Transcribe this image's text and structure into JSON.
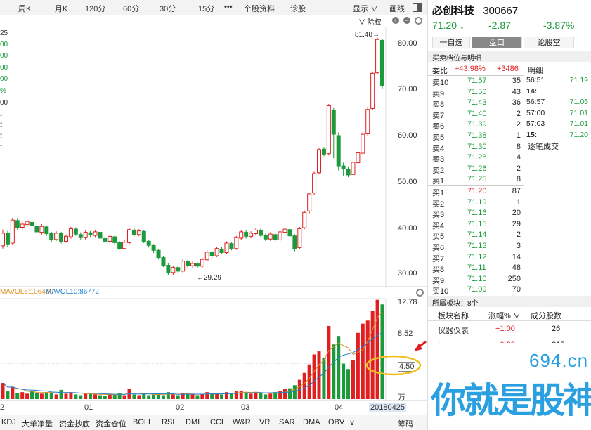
{
  "toolbar": {
    "items": [
      "周K",
      "月K",
      "120分",
      "60分",
      "30分",
      "15分",
      "个股资料",
      "诊股"
    ],
    "more_label": "•••",
    "display_label": "显示",
    "draw_label": "画线",
    "adjust_label": "除权"
  },
  "stock": {
    "name": "必创科技",
    "code": "300667",
    "price": "71.20",
    "arrow": "↓",
    "change": "-2.87",
    "pct": "-3.87%"
  },
  "tabs": {
    "watch": "一自选",
    "orderbook": "盘口",
    "forum": "论股堂"
  },
  "orderbook": {
    "section_title": "买卖档位与明细",
    "weibi_label": "委比",
    "weibi_pct": "+43.98%",
    "weibi_num": "+3486",
    "asks": [
      [
        "卖10",
        "71.57",
        "35"
      ],
      [
        "卖9",
        "71.50",
        "43"
      ],
      [
        "卖8",
        "71.43",
        "36"
      ],
      [
        "卖7",
        "71.40",
        "2"
      ],
      [
        "卖6",
        "71.39",
        "2"
      ],
      [
        "卖5",
        "71.38",
        "1"
      ],
      [
        "卖4",
        "71.30",
        "8"
      ],
      [
        "卖3",
        "71.28",
        "4"
      ],
      [
        "卖2",
        "71.26",
        "2"
      ],
      [
        "卖1",
        "71.25",
        "8"
      ]
    ],
    "bids": [
      [
        "买1",
        "71.20",
        "87"
      ],
      [
        "买2",
        "71.19",
        "1"
      ],
      [
        "买3",
        "71.16",
        "20"
      ],
      [
        "买4",
        "71.15",
        "29"
      ],
      [
        "买5",
        "71.14",
        "2"
      ],
      [
        "买6",
        "71.13",
        "3"
      ],
      [
        "买7",
        "71.12",
        "14"
      ],
      [
        "买8",
        "71.11",
        "48"
      ],
      [
        "买9",
        "71.10",
        "250"
      ],
      [
        "买10",
        "71.09",
        "70"
      ]
    ]
  },
  "ticks": {
    "title": "明细",
    "rows": [
      [
        "56:51",
        "71.19"
      ],
      [
        "14:",
        ""
      ],
      [
        "56:57",
        "71.05"
      ],
      [
        "57:00",
        "71.01"
      ],
      [
        "57:03",
        "71.01"
      ],
      [
        "15:",
        "71.20"
      ]
    ],
    "more": "逐笔成交"
  },
  "sector": {
    "title": "所属板块：8个",
    "col_name": "板块名称",
    "col_chg": "涨幅%",
    "col_cnt": "成分股数",
    "rows": [
      [
        "仪器仪表",
        "+1.00",
        "26"
      ],
      [
        "新股与次",
        "+0.88",
        "215"
      ]
    ]
  },
  "left_labels": [
    "25",
    "00",
    "00",
    "00",
    "00",
    "%",
    "00",
    "--",
    "--",
    "--"
  ],
  "price_axis": [
    "80.00",
    "70.00",
    "60.00",
    "50.00",
    "40.00",
    "30.00"
  ],
  "annotations": {
    "high": "81.48→",
    "low": "←29.29"
  },
  "volume": {
    "mavol5": "MAVOL5:106460",
    "mavol10": "MAVOL10:86772",
    "axis": [
      "12.78",
      "8.52",
      "4.50"
    ],
    "unit": "万"
  },
  "x_labels": [
    "2",
    "01",
    "02",
    "03",
    "04"
  ],
  "date_label": "20180425",
  "bottom_tabs": [
    "KDJ",
    "大单净量",
    "资金抄底",
    "资金仓位",
    "BOLL",
    "RSI",
    "DMI",
    "CCI",
    "W&R",
    "VR",
    "SAR",
    "DMA",
    "OBV"
  ],
  "chip_label": "筹码",
  "watermark": {
    "site": "694.cn",
    "slogan": "你就是股神"
  },
  "colors": {
    "up": "#e02020",
    "down": "#1a9a3a",
    "accent": "#f0c020"
  },
  "chart_data": {
    "type": "candlestick",
    "y_range": [
      28,
      84
    ],
    "candles": [
      [
        35.8,
        38.6,
        35.2,
        39.4
      ],
      [
        38.5,
        36.2,
        35.6,
        39.1
      ],
      [
        36.4,
        41.5,
        36.0,
        42.0
      ],
      [
        41.4,
        39.8,
        39.2,
        42.0
      ],
      [
        39.9,
        40.6,
        39.2,
        41.2
      ],
      [
        40.5,
        41.2,
        40.0,
        41.8
      ],
      [
        41.0,
        40.3,
        39.8,
        41.6
      ],
      [
        40.2,
        38.9,
        38.4,
        40.6
      ],
      [
        38.8,
        40.1,
        38.3,
        40.6
      ],
      [
        40.0,
        38.5,
        38.0,
        40.3
      ],
      [
        38.5,
        37.2,
        36.6,
        38.9
      ],
      [
        37.2,
        38.6,
        36.9,
        39.0
      ],
      [
        38.5,
        36.8,
        36.3,
        38.9
      ],
      [
        36.8,
        37.9,
        36.5,
        38.3
      ],
      [
        37.8,
        39.6,
        37.4,
        40.0
      ],
      [
        39.5,
        38.4,
        38.0,
        39.9
      ],
      [
        38.3,
        37.6,
        37.2,
        38.8
      ],
      [
        37.6,
        38.8,
        37.2,
        39.2
      ],
      [
        38.7,
        38.2,
        37.8,
        39.1
      ],
      [
        38.1,
        38.9,
        37.6,
        39.3
      ],
      [
        38.8,
        37.5,
        37.1,
        39.1
      ],
      [
        37.4,
        36.8,
        36.4,
        37.8
      ],
      [
        36.8,
        37.9,
        36.3,
        38.3
      ],
      [
        37.8,
        36.5,
        36.1,
        38.1
      ],
      [
        36.5,
        35.2,
        34.9,
        36.8
      ],
      [
        35.2,
        36.6,
        35.0,
        37.0
      ],
      [
        36.5,
        39.4,
        36.2,
        39.8
      ],
      [
        39.3,
        38.2,
        37.9,
        39.7
      ],
      [
        38.3,
        39.1,
        37.9,
        39.5
      ],
      [
        39.0,
        36.8,
        36.4,
        39.3
      ],
      [
        36.8,
        35.9,
        35.4,
        37.2
      ],
      [
        35.9,
        34.8,
        34.2,
        36.2
      ],
      [
        34.8,
        33.2,
        32.8,
        35.1
      ],
      [
        33.2,
        31.5,
        31.1,
        33.6
      ],
      [
        31.5,
        29.8,
        29.29,
        31.9
      ],
      [
        29.9,
        31.0,
        29.4,
        31.4
      ],
      [
        31.0,
        30.2,
        29.8,
        31.5
      ],
      [
        30.2,
        32.4,
        29.9,
        32.8
      ],
      [
        32.3,
        31.4,
        31.0,
        32.7
      ],
      [
        31.4,
        31.9,
        31.0,
        32.3
      ],
      [
        31.8,
        31.3,
        30.9,
        32.1
      ],
      [
        31.3,
        32.8,
        31.0,
        33.2
      ],
      [
        32.7,
        34.4,
        32.4,
        34.8
      ],
      [
        34.3,
        33.6,
        33.1,
        34.7
      ],
      [
        33.6,
        35.2,
        33.3,
        35.6
      ],
      [
        35.1,
        34.3,
        33.9,
        35.5
      ],
      [
        34.3,
        36.4,
        34.0,
        36.8
      ],
      [
        36.3,
        35.2,
        34.8,
        36.7
      ],
      [
        35.2,
        37.6,
        34.9,
        38.0
      ],
      [
        37.5,
        38.9,
        37.1,
        39.3
      ],
      [
        38.8,
        37.9,
        37.4,
        39.2
      ],
      [
        37.9,
        38.6,
        37.5,
        39.0
      ],
      [
        38.5,
        39.3,
        38.1,
        39.8
      ],
      [
        39.2,
        38.1,
        37.7,
        39.6
      ],
      [
        38.1,
        37.3,
        36.9,
        38.5
      ],
      [
        37.3,
        38.4,
        36.9,
        38.8
      ],
      [
        38.3,
        37.1,
        36.6,
        38.7
      ],
      [
        37.1,
        38.9,
        36.8,
        39.4
      ],
      [
        38.8,
        39.5,
        38.4,
        40.1
      ],
      [
        39.4,
        38.0,
        36.4,
        39.8
      ],
      [
        38.0,
        35.2,
        34.6,
        38.4
      ],
      [
        35.4,
        39.6,
        35.0,
        40.0
      ],
      [
        39.8,
        43.2,
        39.5,
        43.6
      ],
      [
        43.5,
        47.3,
        43.0,
        47.6
      ],
      [
        47.5,
        51.8,
        47.0,
        52.2
      ],
      [
        52.0,
        57.1,
        51.6,
        57.5
      ],
      [
        57.2,
        56.1,
        55.6,
        57.7
      ],
      [
        56.2,
        66.8,
        55.8,
        67.2
      ],
      [
        65.8,
        60.5,
        55.2,
        66.3
      ],
      [
        60.2,
        53.5,
        52.5,
        60.9
      ],
      [
        53.5,
        52.8,
        51.3,
        54.2
      ],
      [
        52.8,
        51.5,
        51.0,
        53.4
      ],
      [
        51.6,
        54.3,
        51.2,
        54.7
      ],
      [
        54.2,
        56.4,
        53.8,
        56.8
      ],
      [
        56.3,
        60.5,
        55.9,
        61.0
      ],
      [
        60.6,
        66.0,
        60.2,
        66.6
      ],
      [
        66.2,
        74.0,
        65.8,
        74.4
      ],
      [
        74.1,
        81.48,
        73.9,
        81.9
      ],
      [
        81.3,
        71.2,
        70.5,
        81.6
      ]
    ],
    "volume": [
      2.1,
      1.0,
      1.6,
      0.8,
      0.9,
      0.7,
      1.1,
      0.8,
      0.7,
      0.9,
      0.8,
      0.6,
      1.2,
      0.7,
      0.9,
      0.6,
      0.5,
      0.8,
      0.7,
      0.6,
      0.5,
      0.4,
      0.7,
      0.6,
      0.8,
      0.5,
      1.3,
      0.6,
      0.5,
      0.7,
      0.5,
      0.6,
      0.7,
      0.5,
      0.9,
      0.6,
      0.5,
      0.8,
      0.6,
      0.7,
      0.5,
      0.6,
      0.9,
      0.7,
      0.8,
      0.6,
      0.9,
      0.7,
      1.0,
      1.1,
      0.8,
      0.7,
      0.9,
      0.8,
      0.6,
      0.7,
      0.9,
      1.0,
      1.3,
      1.4,
      1.8,
      2.5,
      3.4,
      4.5,
      5.8,
      6.2,
      5.4,
      9.5,
      7.1,
      8.2,
      4.6,
      3.9,
      5.1,
      8.6,
      9.8,
      10.2,
      11.5,
      12.9,
      12.3
    ],
    "vol_range": [
      0,
      12.78
    ]
  }
}
